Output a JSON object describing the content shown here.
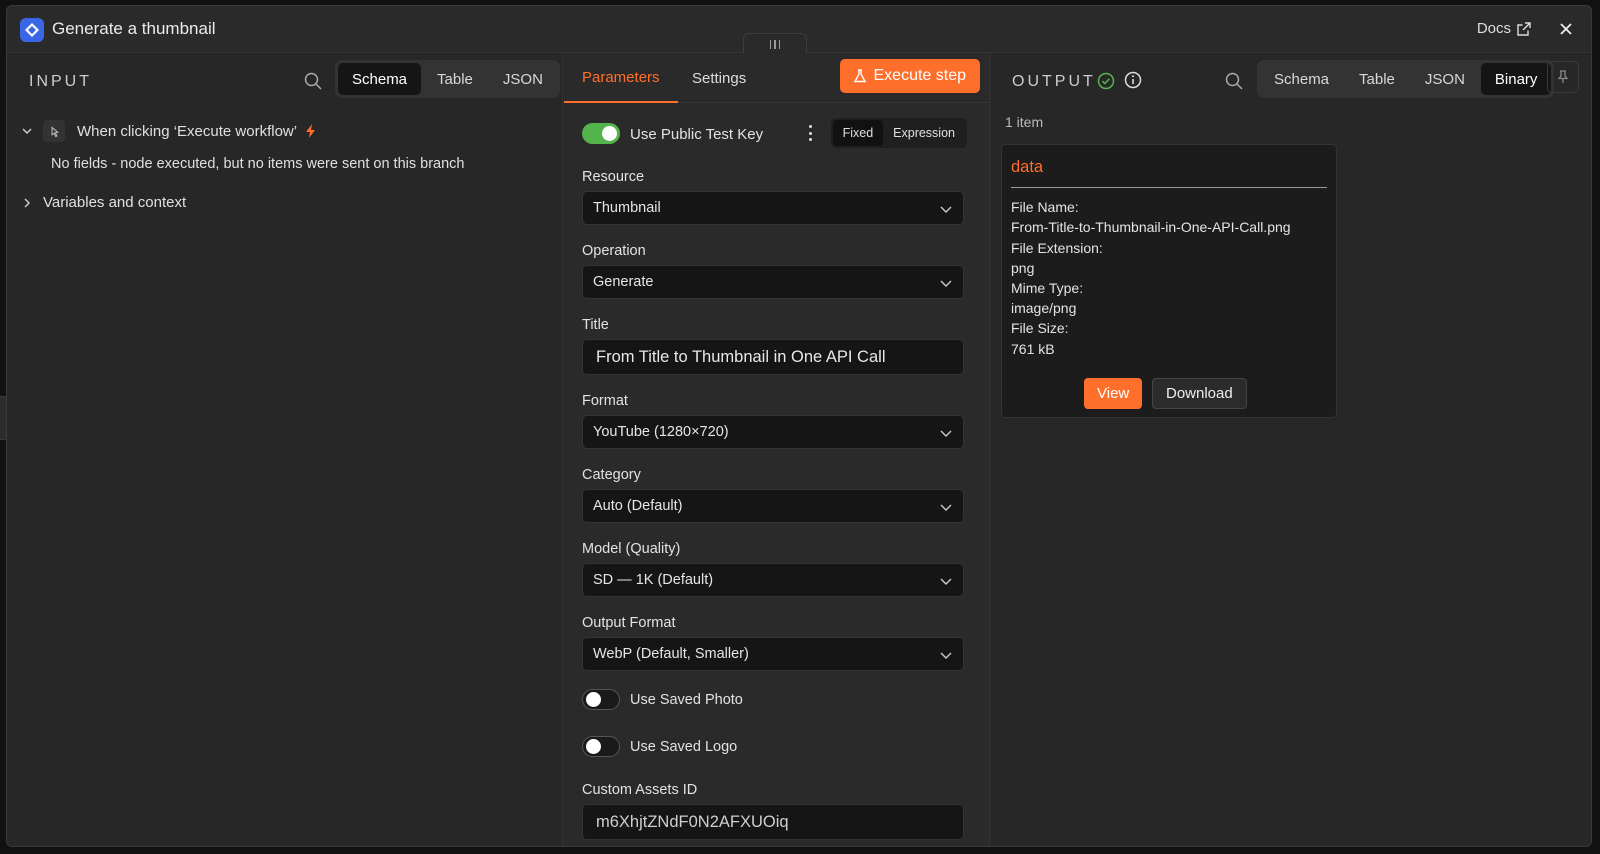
{
  "modal": {
    "title": "Generate a thumbnail",
    "docs_label": "Docs"
  },
  "input": {
    "section_label": "INPUT",
    "view_tabs": [
      "Schema",
      "Table",
      "JSON"
    ],
    "active_tab": "Schema",
    "trigger_label": "When clicking ‘Execute workflow’",
    "no_fields_message": "No fields - node executed, but no items were sent on this branch",
    "variables_label": "Variables and context"
  },
  "params": {
    "tabs": [
      "Parameters",
      "Settings"
    ],
    "active_tab": "Parameters",
    "execute_label": "Execute step",
    "public_key": {
      "label": "Use Public Test Key",
      "enabled": true
    },
    "mode_options": [
      "Fixed",
      "Expression"
    ],
    "active_mode": "Fixed",
    "resource": {
      "label": "Resource",
      "value": "Thumbnail"
    },
    "operation": {
      "label": "Operation",
      "value": "Generate"
    },
    "title_field": {
      "label": "Title",
      "value": "From Title to Thumbnail in One API Call"
    },
    "format": {
      "label": "Format",
      "value": "YouTube (1280×720)"
    },
    "category": {
      "label": "Category",
      "value": "Auto (Default)"
    },
    "model": {
      "label": "Model (Quality)",
      "value": "SD — 1K (Default)"
    },
    "output_format": {
      "label": "Output Format",
      "value": "WebP (Default, Smaller)"
    },
    "saved_photo": {
      "label": "Use Saved Photo",
      "enabled": false
    },
    "saved_logo": {
      "label": "Use Saved Logo",
      "enabled": false
    },
    "custom_assets": {
      "label": "Custom Assets ID",
      "value": "m6XhjtZNdF0N2AFXUOiq"
    }
  },
  "output": {
    "section_label": "OUTPUT",
    "view_tabs": [
      "Schema",
      "Table",
      "JSON",
      "Binary"
    ],
    "active_tab": "Binary",
    "item_count": "1 item",
    "card": {
      "title": "data",
      "file_name_label": "File Name:",
      "file_name": "From-Title-to-Thumbnail-in-One-API-Call.png",
      "file_ext_label": "File Extension:",
      "file_ext": "png",
      "mime_label": "Mime Type:",
      "mime": "image/png",
      "size_label": "File Size:",
      "size": "761 kB",
      "view_label": "View",
      "download_label": "Download"
    }
  },
  "colors": {
    "accent": "#ff6f2c",
    "success": "#54b44c",
    "brand": "#3a67e8"
  }
}
